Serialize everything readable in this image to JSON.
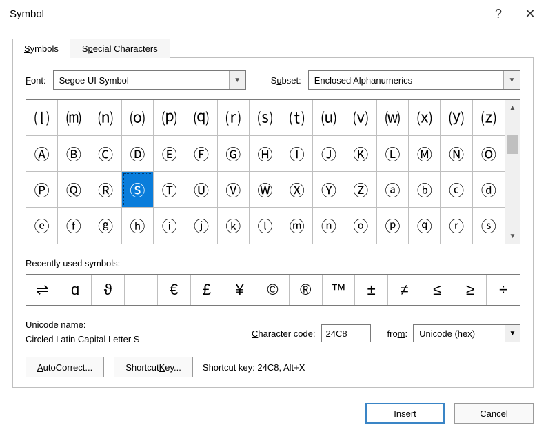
{
  "titlebar": {
    "title": "Symbol",
    "help": "?",
    "close": "✕"
  },
  "tabs": {
    "symbols": {
      "u": "S",
      "rest": "ymbols"
    },
    "special": {
      "pre": "S",
      "u": "p",
      "post": "ecial Characters"
    }
  },
  "labels": {
    "font": {
      "u": "F",
      "rest": "ont:"
    },
    "subset": {
      "pre": "S",
      "u": "u",
      "post": "bset:"
    },
    "recent": {
      "u": "R",
      "rest": "ecently used symbols:"
    },
    "unicode_name": "Unicode name:",
    "char_code": {
      "u": "C",
      "rest": "haracter code:"
    },
    "from": {
      "pre": "fro",
      "u": "m",
      "post": ":"
    }
  },
  "font": {
    "value": "Segoe UI Symbol"
  },
  "subset": {
    "value": "Enclosed Alphanumerics"
  },
  "grid": [
    "⒧",
    "⒨",
    "⒩",
    "⒪",
    "⒫",
    "⒬",
    "⒭",
    "⒮",
    "⒯",
    "⒰",
    "⒱",
    "⒲",
    "⒳",
    "⒴",
    "⒵",
    "Ⓐ",
    "Ⓑ",
    "Ⓒ",
    "Ⓓ",
    "Ⓔ",
    "Ⓕ",
    "Ⓖ",
    "Ⓗ",
    "Ⓘ",
    "Ⓙ",
    "Ⓚ",
    "Ⓛ",
    "Ⓜ",
    "Ⓝ",
    "Ⓞ",
    "Ⓟ",
    "Ⓠ",
    "Ⓡ",
    "Ⓢ",
    "Ⓣ",
    "Ⓤ",
    "Ⓥ",
    "Ⓦ",
    "Ⓧ",
    "Ⓨ",
    "Ⓩ",
    "ⓐ",
    "ⓑ",
    "ⓒ",
    "ⓓ",
    "ⓔ",
    "ⓕ",
    "ⓖ",
    "ⓗ",
    "ⓘ",
    "ⓙ",
    "ⓚ",
    "ⓛ",
    "ⓜ",
    "ⓝ",
    "ⓞ",
    "ⓟ",
    "ⓠ",
    "ⓡ",
    "ⓢ"
  ],
  "selected_index": 33,
  "recent": [
    "⇌",
    "ɑ",
    "ϑ",
    "",
    "€",
    "£",
    "¥",
    "©",
    "®",
    "™",
    "±",
    "≠",
    "≤",
    "≥",
    "÷"
  ],
  "unicode_name_value": "Circled Latin Capital Letter S",
  "char_code": "24C8",
  "from_value": "Unicode (hex)",
  "buttons": {
    "autocorrect": {
      "u": "A",
      "rest": "utoCorrect..."
    },
    "shortcut_key": {
      "pre": "Shortcut ",
      "u": "K",
      "post": "ey..."
    },
    "shortcut_text": "Shortcut key: 24C8, Alt+X",
    "insert": {
      "u": "I",
      "rest": "nsert"
    },
    "cancel": "Cancel"
  }
}
